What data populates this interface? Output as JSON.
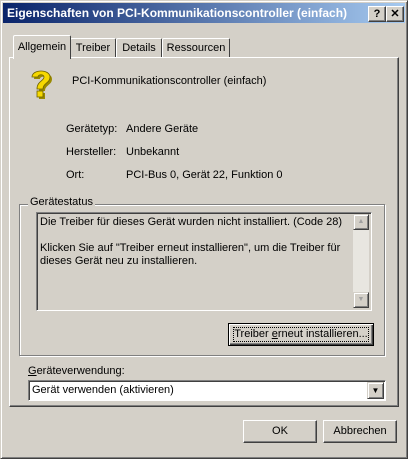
{
  "window": {
    "title": "Eigenschaften von PCI-Kommunikationscontroller (einfach)",
    "help_glyph": "?",
    "close_glyph": "✕"
  },
  "tabs": [
    {
      "label": "Allgemein",
      "active": true
    },
    {
      "label": "Treiber"
    },
    {
      "label": "Details"
    },
    {
      "label": "Ressourcen"
    }
  ],
  "device": {
    "name": "PCI-Kommunikationscontroller (einfach)",
    "icon": "question-mark-icon",
    "fields": [
      {
        "label": "Gerätetyp:",
        "value": "Andere Geräte"
      },
      {
        "label": "Hersteller:",
        "value": "Unbekannt"
      },
      {
        "label": "Ort:",
        "value": "PCI-Bus 0, Gerät 22, Funktion 0"
      }
    ]
  },
  "status": {
    "group_title": "Gerätestatus",
    "line1": "Die Treiber für dieses Gerät wurden nicht installiert. (Code 28)",
    "line2": "Klicken Sie auf \"Treiber erneut installieren\", um die Treiber für dieses Gerät neu zu installieren.",
    "reinstall_button": {
      "pre": "Treiber ",
      "accel": "e",
      "post": "rneut installieren..."
    }
  },
  "usage": {
    "label_accel": "G",
    "label_rest": "eräteverwendung:",
    "selected": "Gerät verwenden (aktivieren)"
  },
  "buttons": {
    "ok": "OK",
    "cancel": "Abbrechen"
  },
  "colors": {
    "titlebar_start": "#0a246a",
    "titlebar_end": "#a6caf0",
    "face": "#d4d0c8",
    "icon_yellow": "#f6d800"
  }
}
